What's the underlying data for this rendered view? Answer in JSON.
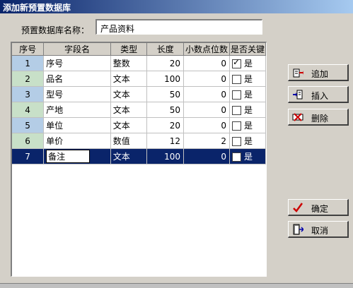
{
  "window": {
    "title": "添加新预置数据库"
  },
  "form": {
    "name_label": "预置数据库名称：",
    "name_value": "产品资料"
  },
  "table": {
    "headers": [
      "序号",
      "字段名",
      "类型",
      "长度",
      "小数点位数",
      "是否关键"
    ],
    "rows": [
      {
        "no": "1",
        "field": "序号",
        "type": "整数",
        "len": "20",
        "dec": "0",
        "key_checked": true,
        "key_label": "是"
      },
      {
        "no": "2",
        "field": "品名",
        "type": "文本",
        "len": "100",
        "dec": "0",
        "key_checked": false,
        "key_label": "是"
      },
      {
        "no": "3",
        "field": "型号",
        "type": "文本",
        "len": "50",
        "dec": "0",
        "key_checked": false,
        "key_label": "是"
      },
      {
        "no": "4",
        "field": "产地",
        "type": "文本",
        "len": "50",
        "dec": "0",
        "key_checked": false,
        "key_label": "是"
      },
      {
        "no": "5",
        "field": "单位",
        "type": "文本",
        "len": "20",
        "dec": "0",
        "key_checked": false,
        "key_label": "是"
      },
      {
        "no": "6",
        "field": "单价",
        "type": "数值",
        "len": "12",
        "dec": "2",
        "key_checked": false,
        "key_label": "是"
      },
      {
        "no": "7",
        "field": "备注",
        "type": "文本",
        "len": "100",
        "dec": "0",
        "key_checked": false,
        "key_label": "是"
      }
    ],
    "selected_row": 7
  },
  "buttons": {
    "append": "追加",
    "insert": "插入",
    "delete": "删除",
    "ok": "确定",
    "cancel": "取消"
  },
  "colors": {
    "title_start": "#0a246a",
    "title_end": "#a6caf0",
    "selection": "#0a246a"
  }
}
